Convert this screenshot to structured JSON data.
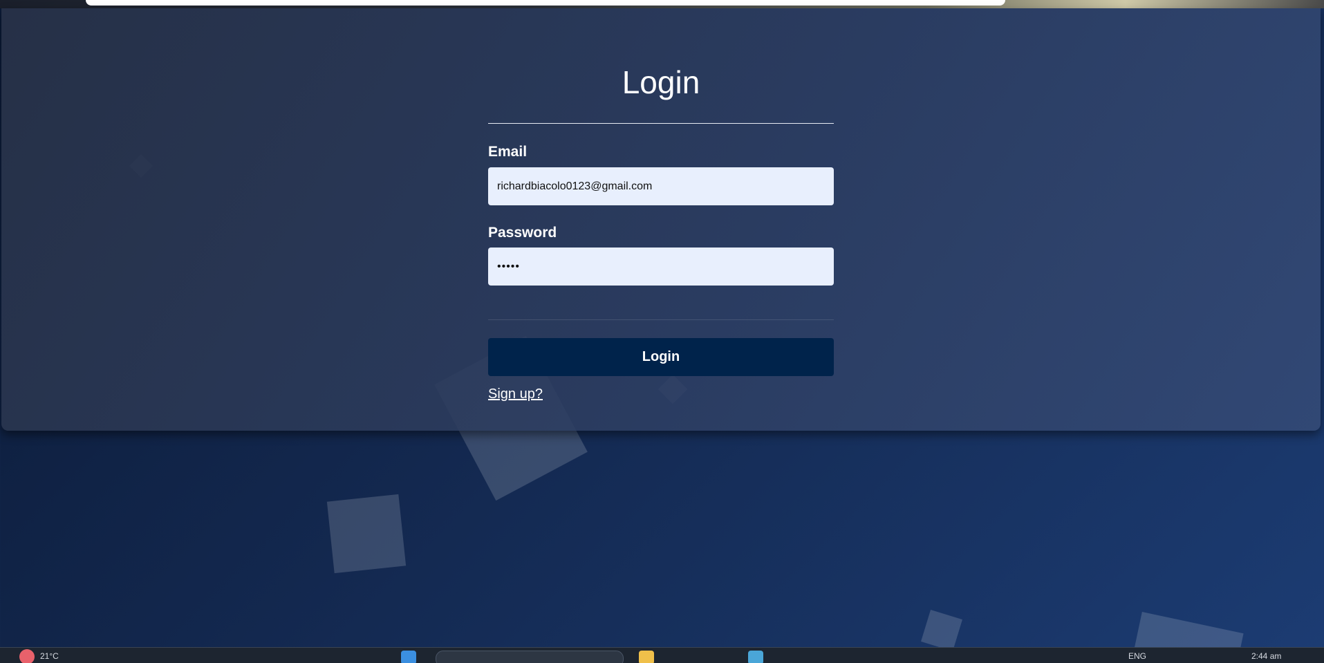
{
  "login_form": {
    "title": "Login",
    "email_label": "Email",
    "email_value": "richardbiacolo0123@gmail.com",
    "password_label": "Password",
    "password_value": "•••••",
    "submit_label": "Login",
    "signup_link": "Sign up?"
  },
  "taskbar": {
    "temperature": "21°C",
    "language": "ENG",
    "clock": "2:44 am"
  },
  "colors": {
    "background": "#13284f",
    "panel": "#2d3e62",
    "input_background": "#e8effd",
    "button": "#00234b",
    "text": "#ffffff"
  },
  "icons": [
    "windows-start-icon",
    "search-icon",
    "file-explorer-icon",
    "browser-icon",
    "weather-icon"
  ]
}
